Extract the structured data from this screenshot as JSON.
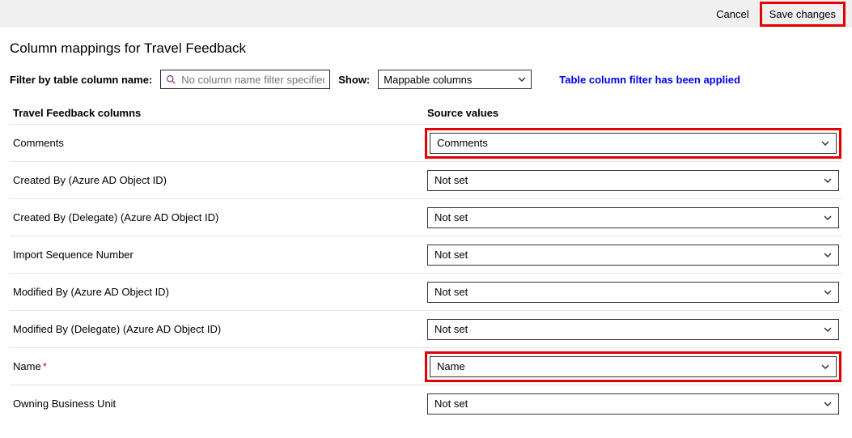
{
  "toolbar": {
    "cancel_label": "Cancel",
    "save_label": "Save changes"
  },
  "page": {
    "title": "Column mappings for Travel Feedback"
  },
  "filter": {
    "label": "Filter by table column name:",
    "placeholder": "No column name filter specified",
    "show_label": "Show:",
    "show_value": "Mappable columns",
    "applied_msg": "Table column filter has been applied"
  },
  "columns": {
    "left_header": "Travel Feedback columns",
    "right_header": "Source values"
  },
  "rows": [
    {
      "label": "Comments",
      "required": false,
      "source": "Comments",
      "highlight": true
    },
    {
      "label": "Created By (Azure AD Object ID)",
      "required": false,
      "source": "Not set",
      "highlight": false
    },
    {
      "label": "Created By (Delegate) (Azure AD Object ID)",
      "required": false,
      "source": "Not set",
      "highlight": false
    },
    {
      "label": "Import Sequence Number",
      "required": false,
      "source": "Not set",
      "highlight": false
    },
    {
      "label": "Modified By (Azure AD Object ID)",
      "required": false,
      "source": "Not set",
      "highlight": false
    },
    {
      "label": "Modified By (Delegate) (Azure AD Object ID)",
      "required": false,
      "source": "Not set",
      "highlight": false
    },
    {
      "label": "Name",
      "required": true,
      "source": "Name",
      "highlight": true
    },
    {
      "label": "Owning Business Unit",
      "required": false,
      "source": "Not set",
      "highlight": false
    }
  ]
}
